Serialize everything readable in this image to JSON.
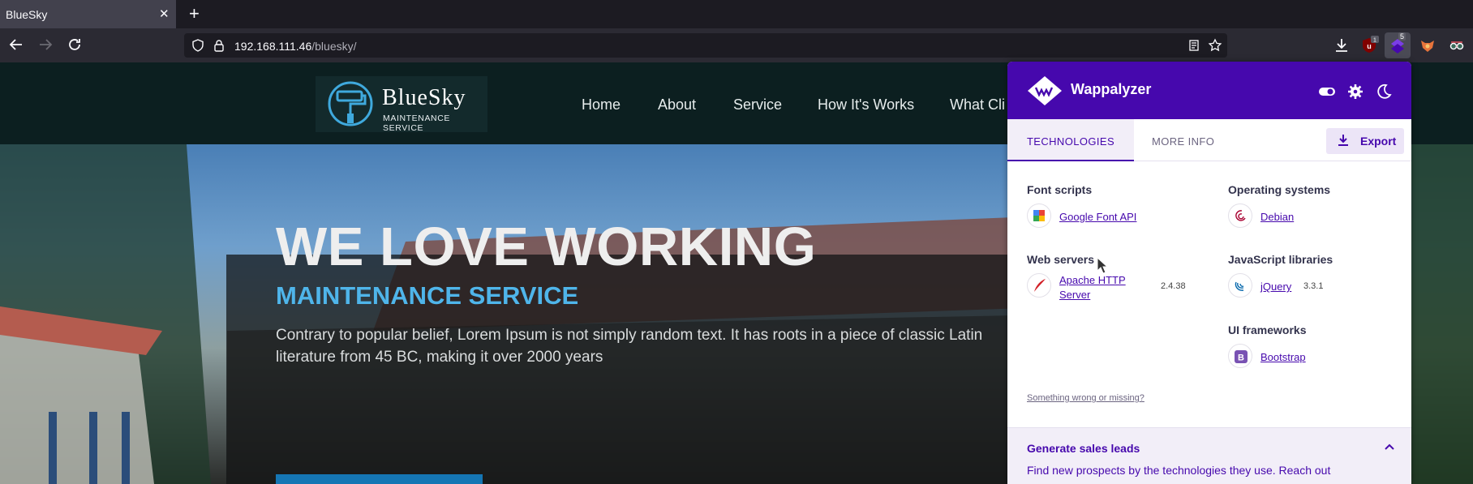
{
  "browser": {
    "tab_title": "BlueSky",
    "tab_close": "✕",
    "new_tab": "+",
    "url_host": "192.168.111.46",
    "url_path": "/bluesky/",
    "extension_badges": {
      "ublock": "1",
      "wappalyzer": "5"
    }
  },
  "site": {
    "logo_word": "BlueSky",
    "logo_sub": "MAINTENANCE SERVICE",
    "menu": [
      "Home",
      "About",
      "Service",
      "How It's Works",
      "What Cli"
    ],
    "hero_title": "WE LOVE WORKING",
    "hero_subtitle": "MAINTENANCE SERVICE",
    "hero_body": "Contrary to popular belief, Lorem Ipsum is not simply random text. It has roots in a piece of classic Latin literature from 45 BC, making it over 2000 years"
  },
  "wappalyzer": {
    "title": "Wappalyzer",
    "tabs": [
      "TECHNOLOGIES",
      "MORE INFO"
    ],
    "export_label": "Export",
    "categories": [
      {
        "name": "Font scripts",
        "techs": [
          {
            "name": "Google Font API",
            "version": ""
          }
        ]
      },
      {
        "name": "Web servers",
        "techs": [
          {
            "name": "Apache HTTP Server",
            "version": "2.4.38"
          }
        ]
      },
      {
        "name": "Operating systems",
        "techs": [
          {
            "name": "Debian",
            "version": ""
          }
        ]
      },
      {
        "name": "JavaScript libraries",
        "techs": [
          {
            "name": "jQuery",
            "version": "3.3.1"
          }
        ]
      },
      {
        "name": "UI frameworks",
        "techs": [
          {
            "name": "Bootstrap",
            "version": ""
          }
        ]
      }
    ],
    "wrong_link": "Something wrong or missing?",
    "leads_title": "Generate sales leads",
    "leads_body": "Find new prospects by the technologies they use. Reach out",
    "accent_color": "#4608ad"
  }
}
